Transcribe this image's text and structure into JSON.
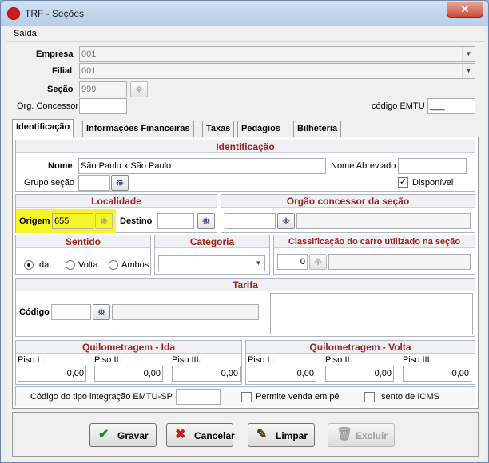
{
  "window": {
    "title": "TRF - Seções",
    "close_glyph": "✕"
  },
  "menu": {
    "items": [
      "Saída"
    ]
  },
  "header": {
    "empresa_label": "Empresa",
    "empresa_value": "001",
    "filial_label": "Filial",
    "filial_value": "001",
    "secao_label": "Seção",
    "secao_value": "999",
    "org_concessor_label": "Org. Concessor",
    "org_concessor_value": "",
    "codigo_emtu_label": "código EMTU",
    "codigo_emtu_value": "___"
  },
  "tabs": [
    "Identificação",
    "Informações Financeiras",
    "Taxas",
    "Pedágios",
    "Bilheteria"
  ],
  "identificacao": {
    "section_title": "Identificação",
    "nome_label": "Nome",
    "nome_value": "São Paulo x São Paulo",
    "nome_abreviado_label": "Nome Abreviado",
    "nome_abreviado_value": "",
    "grupo_secao_label": "Grupo seção",
    "grupo_secao_value": "",
    "disponivel_label": "Disponível",
    "disponivel_checked": true
  },
  "localidade": {
    "section_title": "Localidade",
    "origem_label": "Origem",
    "origem_value": "655",
    "destino_label": "Destino",
    "destino_value": ""
  },
  "orgao": {
    "section_title": "Orgão concessor da seção",
    "value": ""
  },
  "sentido": {
    "section_title": "Sentido",
    "options": [
      "Ida",
      "Volta",
      "Ambos"
    ],
    "selected": "Ida"
  },
  "categoria": {
    "section_title": "Categoria",
    "value": ""
  },
  "classificacao": {
    "section_title": "Classificação do carro utilizado na seção",
    "value": "0"
  },
  "tarifa": {
    "section_title": "Tarifa",
    "codigo_label": "Código",
    "codigo_value": ""
  },
  "km_ida": {
    "section_title": "Quilometragem - Ida",
    "labels": [
      "Piso I :",
      "Piso II:",
      "Piso III:"
    ],
    "values": [
      "0,00",
      "0,00",
      "0,00"
    ]
  },
  "km_volta": {
    "section_title": "Quilometragem - Volta",
    "labels": [
      "Piso I :",
      "Piso II:",
      "Piso III:"
    ],
    "values": [
      "0,00",
      "0,00",
      "0,00"
    ]
  },
  "rodape": {
    "emtu_integracao_label": "Código do tipo integração EMTU-SP",
    "emtu_integracao_value": "",
    "permite_venda_label": "Permite venda em pé",
    "isento_icms_label": "Isento de ICMS"
  },
  "buttons": {
    "gravar": "Gravar",
    "cancelar": "Cancelar",
    "limpar": "Limpar",
    "excluir": "Excluir"
  },
  "icons": {
    "search": "binoculars-icon",
    "gravar": "checkmark-icon",
    "cancelar": "x-icon",
    "limpar": "brush-icon",
    "excluir": "trash-icon"
  },
  "colors": {
    "section_title": "#a0201b",
    "highlight": "#f5f528",
    "gravar_icon": "#1e8a1e",
    "cancelar_icon": "#c81e1e"
  }
}
